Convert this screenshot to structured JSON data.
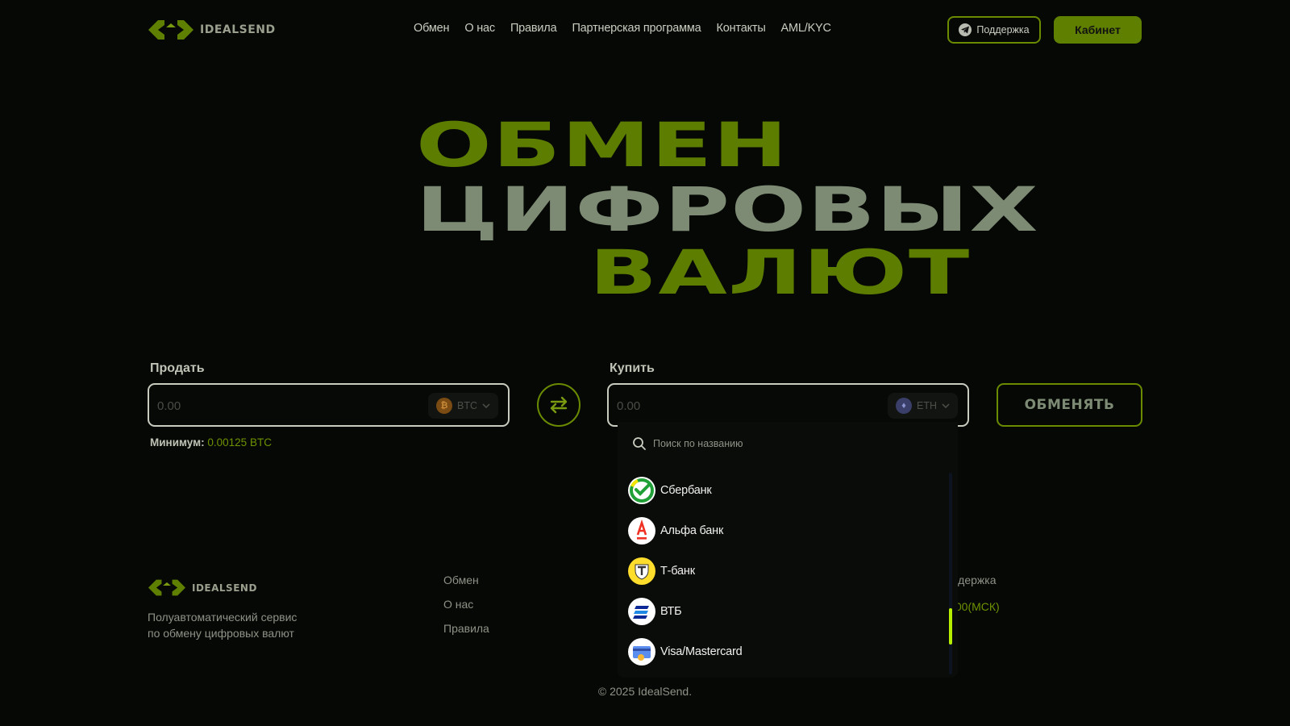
{
  "brand": {
    "name": "IDEALSEND",
    "footer_name": "IDEALSEND",
    "accent": "#5f7f00",
    "bright_accent": "#b6f000"
  },
  "nav": {
    "items": [
      {
        "label": "Обмен"
      },
      {
        "label": "О нас"
      },
      {
        "label": "Правила"
      },
      {
        "label": "Партнерская программа"
      },
      {
        "label": "Контакты"
      },
      {
        "label": "AML/KYC"
      }
    ]
  },
  "header": {
    "support_label": "Поддержка",
    "support_icon": "telegram-icon",
    "cabinet_label": "Кабинет"
  },
  "hero": {
    "line1": "ОБМЕН",
    "line2": "ЦИФРОВЫХ",
    "line3": "ВАЛЮТ"
  },
  "exchange": {
    "sell": {
      "label": "Продать",
      "placeholder": "0.00",
      "currency": "BTC",
      "currency_icon": "bitcoin-icon"
    },
    "buy": {
      "label": "Купить",
      "placeholder": "0.00",
      "currency": "ETH",
      "currency_icon": "ethereum-icon"
    },
    "minimum_label": "Минимум:",
    "minimum_value": "0.00125 BTC",
    "submit_label": "ОБМЕНЯТЬ"
  },
  "dropdown": {
    "search_placeholder": "Поиск по названию",
    "banks": [
      {
        "name": "Сбербанк",
        "icon": "sberbank-icon"
      },
      {
        "name": "Альфа банк",
        "icon": "alfa-bank-icon"
      },
      {
        "name": "Т-банк",
        "icon": "t-bank-icon"
      },
      {
        "name": "ВТБ",
        "icon": "vtb-icon"
      },
      {
        "name": "Visa/Mastercard",
        "icon": "card-icon"
      }
    ],
    "scroll_position": 0.82,
    "scroll_visible_fraction": 0.18
  },
  "footer": {
    "description": "Полуавтоматический сервис по обмену цифровых валют",
    "links": [
      {
        "label": "Обмен"
      },
      {
        "label": "О нас"
      },
      {
        "label": "Правила"
      }
    ],
    "support_partial": "ддержка",
    "hours_partial": ":00(МСК)",
    "copyright": "© 2025 IdealSend."
  }
}
